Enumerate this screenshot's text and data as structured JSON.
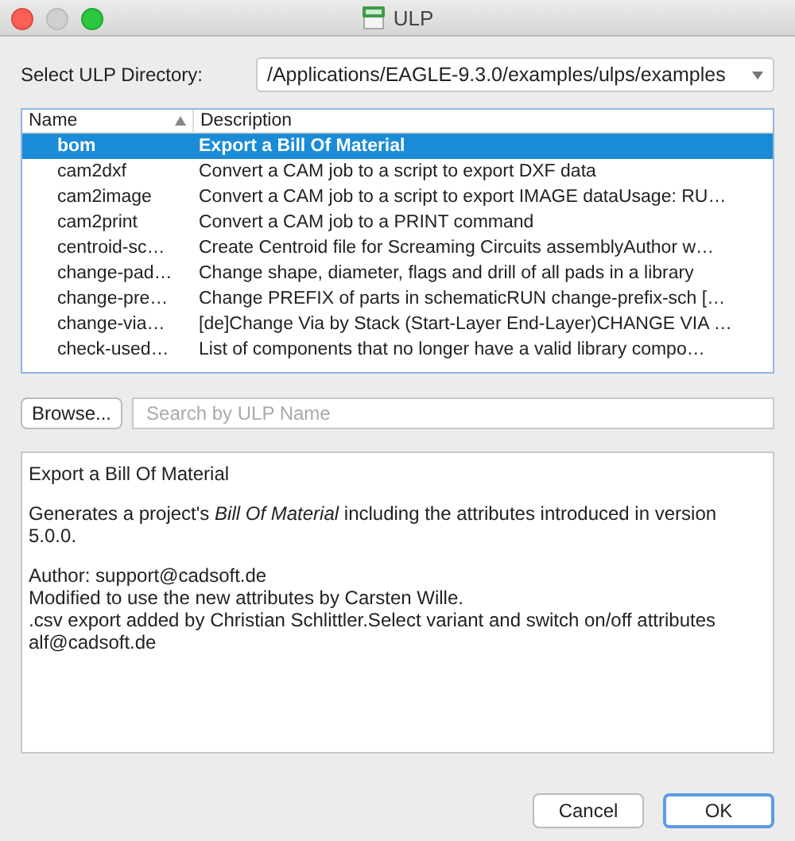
{
  "window": {
    "title": "ULP"
  },
  "directory": {
    "label": "Select ULP Directory:",
    "value": "/Applications/EAGLE-9.3.0/examples/ulps/examples"
  },
  "table": {
    "columns": [
      {
        "label": "Name",
        "sorted": true
      },
      {
        "label": "Description",
        "sorted": false
      }
    ],
    "rows": [
      {
        "name": "bom",
        "description": "Export a Bill Of Material",
        "selected": true
      },
      {
        "name": "cam2dxf",
        "description": "Convert a CAM job to a script to export DXF data",
        "selected": false
      },
      {
        "name": "cam2image",
        "description": "Convert a CAM job to a script to export IMAGE dataUsage: RU…",
        "selected": false
      },
      {
        "name": "cam2print",
        "description": "Convert a CAM job to a PRINT command",
        "selected": false
      },
      {
        "name": "centroid-sc…",
        "description": "Create Centroid file for Screaming Circuits assemblyAuthor w…",
        "selected": false
      },
      {
        "name": "change-pad…",
        "description": "Change shape, diameter, flags and drill of all pads in a library",
        "selected": false
      },
      {
        "name": "change-pre…",
        "description": "Change PREFIX of parts in schematicRUN change-prefix-sch […",
        "selected": false
      },
      {
        "name": "change-via…",
        "description": "[de]Change Via by Stack (Start-Layer End-Layer)CHANGE VIA …",
        "selected": false
      },
      {
        "name": "check-used…",
        "description": "List of components that no longer have a valid library compo…",
        "selected": false
      }
    ]
  },
  "browse_button": "Browse...",
  "search": {
    "placeholder": "Search by ULP Name"
  },
  "details": [
    [
      "Export a Bill Of Material"
    ],
    [
      "Generates a project's *Bill Of Material*  including the attributes introduced in version 5.0.0."
    ],
    [
      "Author: support@cadsoft.de",
      "Modified to use the new attributes by Carsten Wille.",
      ".csv export added by Christian Schlittler.Select variant and switch on/off attributes alf@cadsoft.de"
    ]
  ],
  "buttons": [
    {
      "label": "Cancel",
      "default": false
    },
    {
      "label": "OK",
      "default": true
    }
  ]
}
